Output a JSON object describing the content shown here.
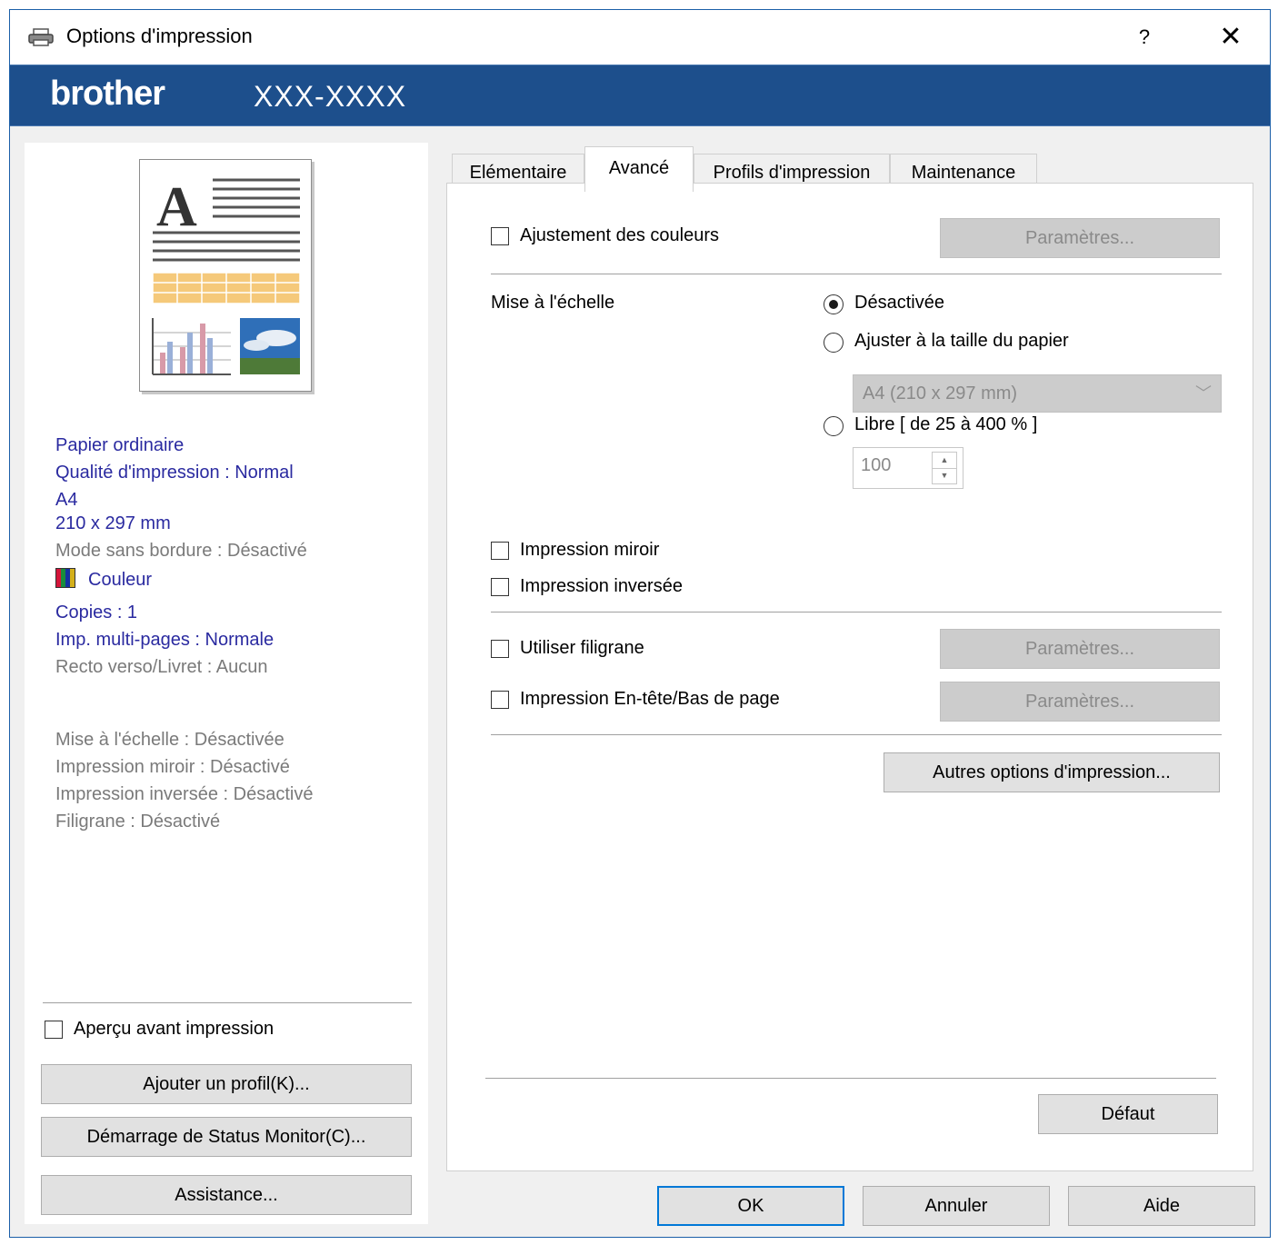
{
  "window": {
    "title": "Options d'impression",
    "help_label": "?",
    "close_label": "✕"
  },
  "brand": {
    "logo": "brother",
    "model": "XXX-XXXX"
  },
  "summary": {
    "paper_type": "Papier ordinaire",
    "quality": "Qualité d'impression : Normal",
    "size_name": "A4",
    "size_dims": "210 x 297 mm",
    "borderless": "Mode sans bordure : Désactivé",
    "color": "Couleur",
    "copies": "Copies : 1",
    "multipage": "Imp. multi-pages : Normale",
    "duplex": "Recto verso/Livret : Aucun",
    "scaling": "Mise à l'échelle : Désactivée",
    "mirror": "Impression miroir : Désactivé",
    "reverse": "Impression inversée : Désactivé",
    "watermark": "Filigrane : Désactivé"
  },
  "left_controls": {
    "preview_checkbox": "Aperçu avant impression",
    "preview_checked": false,
    "add_profile": "Ajouter un profil(K)...",
    "status_monitor": "Démarrage de Status Monitor(C)...",
    "assistance": "Assistance..."
  },
  "tabs": [
    {
      "label": "Elémentaire",
      "active": false
    },
    {
      "label": "Avancé",
      "active": true
    },
    {
      "label": "Profils d'impression",
      "active": false
    },
    {
      "label": "Maintenance",
      "active": false
    }
  ],
  "advanced": {
    "color_adjust_label": "Ajustement des couleurs",
    "color_adjust_checked": false,
    "settings_label": "Paramètres...",
    "scaling_label": "Mise à l'échelle",
    "scaling_options": [
      {
        "label": "Désactivée",
        "selected": true
      },
      {
        "label": "Ajuster à la taille du papier",
        "selected": false
      },
      {
        "label": "Libre [ de 25 à 400 % ]",
        "selected": false
      }
    ],
    "paper_size_select": "A4 (210 x 297 mm)",
    "free_value": "100",
    "mirror_label": "Impression miroir",
    "mirror_checked": false,
    "reverse_label": "Impression inversée",
    "reverse_checked": false,
    "watermark_label": "Utiliser filigrane",
    "watermark_checked": false,
    "header_footer_label": "Impression En-tête/Bas de page",
    "header_footer_checked": false,
    "other_options": "Autres options d'impression...",
    "default_label": "Défaut"
  },
  "footer": {
    "ok": "OK",
    "cancel": "Annuler",
    "help": "Aide"
  },
  "colors": {
    "brand_bar": "#1d4f8c",
    "summary_blue": "#2a2aa0",
    "summary_gray": "#7a7a7a"
  }
}
